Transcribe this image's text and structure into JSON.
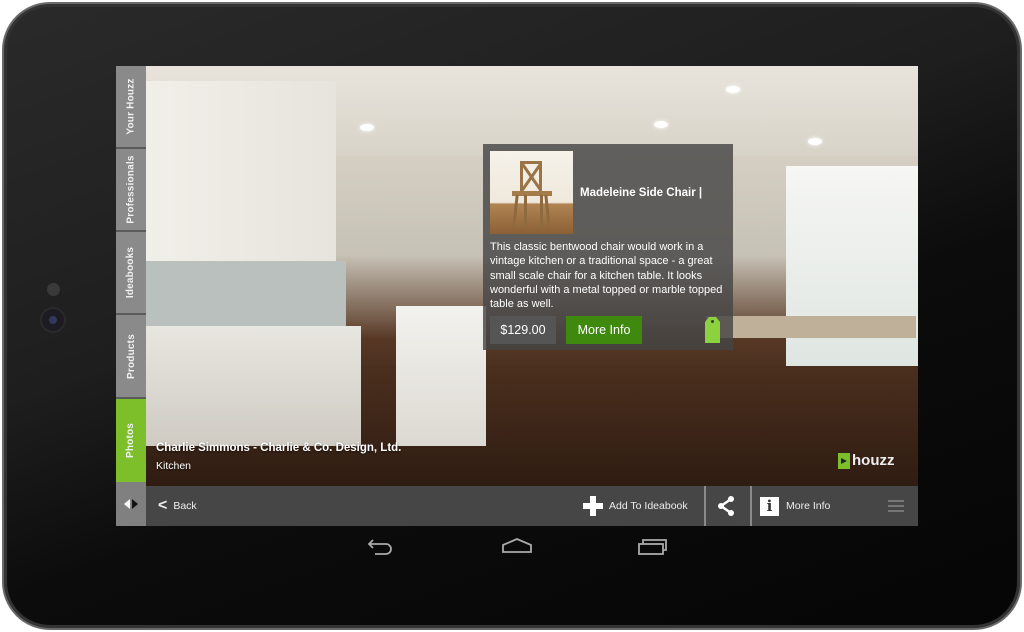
{
  "sidebar": {
    "tabs": [
      {
        "label": "Your Houzz",
        "active": false
      },
      {
        "label": "Professionals",
        "active": false
      },
      {
        "label": "Ideabooks",
        "active": false
      },
      {
        "label": "Products",
        "active": false
      },
      {
        "label": "Photos",
        "active": true
      }
    ],
    "toggle_icon": "sidebar-toggle-icon"
  },
  "photo": {
    "credit_name": "Charlie Simmons - Charlie & Co. Design, Ltd.",
    "room": "Kitchen",
    "brand": "houzz"
  },
  "product_popup": {
    "title": "Madeleine Side Chair |",
    "description": "This classic bentwood chair would work in a vintage kitchen or a traditional space - a great small scale chair for a kitchen table. It looks wonderful with a metal topped or marble topped table as well.",
    "price": "$129.00",
    "more_info_label": "More Info",
    "tag_icon": "price-tag-icon"
  },
  "bottombar": {
    "back_label": "Back",
    "add_ideabook_label": "Add To Ideabook",
    "share_icon": "share-icon",
    "more_info_label": "More Info",
    "menu_icon": "overflow-menu-icon"
  },
  "system_nav": {
    "back": "back-icon",
    "home": "home-icon",
    "recents": "recent-apps-icon"
  },
  "colors": {
    "accent_green": "#7cbf2a",
    "button_green": "#3f8a0e",
    "bar_gray": "#464646"
  }
}
